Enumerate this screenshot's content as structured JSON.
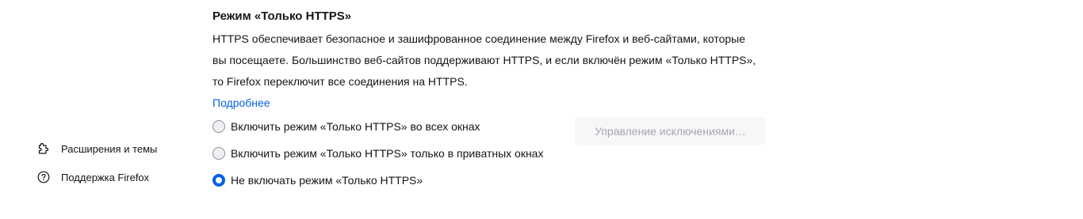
{
  "sidebar": {
    "extensions": {
      "label": "Расширения и темы",
      "icon": "puzzle-icon"
    },
    "support": {
      "label": "Поддержка Firefox",
      "icon": "help-icon"
    }
  },
  "https_only": {
    "title": "Режим «Только HTTPS»",
    "description": "HTTPS обеспечивает безопасное и зашифрованное соединение между Firefox и веб-сайтами, которые вы посещаете. Большинство веб-сайтов поддерживают HTTPS, и если включён режим «Только HTTPS», то Firefox переключит все соединения на HTTPS.",
    "learn_more": "Подробнее",
    "options": [
      {
        "label": "Включить режим «Только HTTPS» во всех окнах",
        "checked": false
      },
      {
        "label": "Включить режим «Только HTTPS» только в приватных окнах",
        "checked": false
      },
      {
        "label": "Не включать режим «Только HTTPS»",
        "checked": true
      }
    ],
    "manage_exceptions": "Управление исключениями…"
  },
  "colors": {
    "accent": "#0061e0",
    "text": "#15141a",
    "disabled_text": "#a7a7ad"
  }
}
